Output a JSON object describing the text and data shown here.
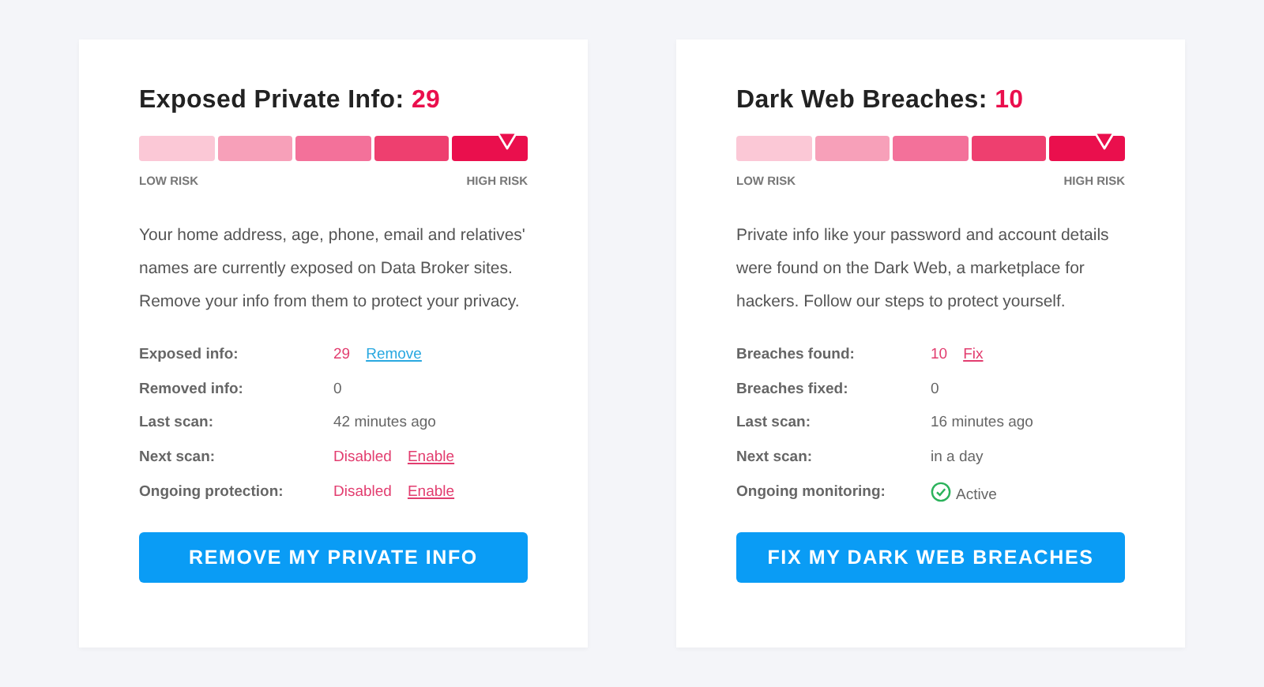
{
  "cards": [
    {
      "title": "Exposed Private Info:",
      "count": "29",
      "meter": {
        "low_label": "LOW RISK",
        "high_label": "HIGH RISK"
      },
      "description": "Your home address, age, phone, email and relatives' names are currently exposed on Data Broker sites. Remove your info from them to protect your privacy.",
      "rows": [
        {
          "label": "Exposed info:",
          "kind": "alert",
          "value": "29",
          "link": {
            "text": "Remove",
            "color": "#29a8e0"
          }
        },
        {
          "label": "Removed info:",
          "kind": "plain",
          "value": "0"
        },
        {
          "label": "Last scan:",
          "kind": "plain",
          "value": "42 minutes ago"
        },
        {
          "label": "Next scan:",
          "kind": "alert",
          "value": "Disabled",
          "link": {
            "text": "Enable",
            "color": "#e23d6f"
          }
        },
        {
          "label": "Ongoing protection:",
          "kind": "alert",
          "value": "Disabled",
          "link": {
            "text": "Enable",
            "color": "#e23d6f"
          }
        }
      ],
      "button": "REMOVE MY PRIVATE INFO"
    },
    {
      "title": "Dark Web Breaches:",
      "count": "10",
      "meter": {
        "low_label": "LOW RISK",
        "high_label": "HIGH RISK"
      },
      "description": "Private info like your password and account details were found on the Dark Web, a marketplace for hackers. Follow our steps to protect yourself.",
      "rows": [
        {
          "label": "Breaches found:",
          "kind": "alert",
          "value": "10",
          "link": {
            "text": "Fix",
            "color": "#e23d6f"
          }
        },
        {
          "label": "Breaches fixed:",
          "kind": "plain",
          "value": "0"
        },
        {
          "label": "Last scan:",
          "kind": "plain",
          "value": "16 minutes ago"
        },
        {
          "label": "Next scan:",
          "kind": "plain",
          "value": "in a day"
        },
        {
          "label": "Ongoing monitoring:",
          "kind": "active",
          "value": "Active"
        }
      ],
      "button": "FIX MY DARK WEB BREACHES"
    }
  ]
}
